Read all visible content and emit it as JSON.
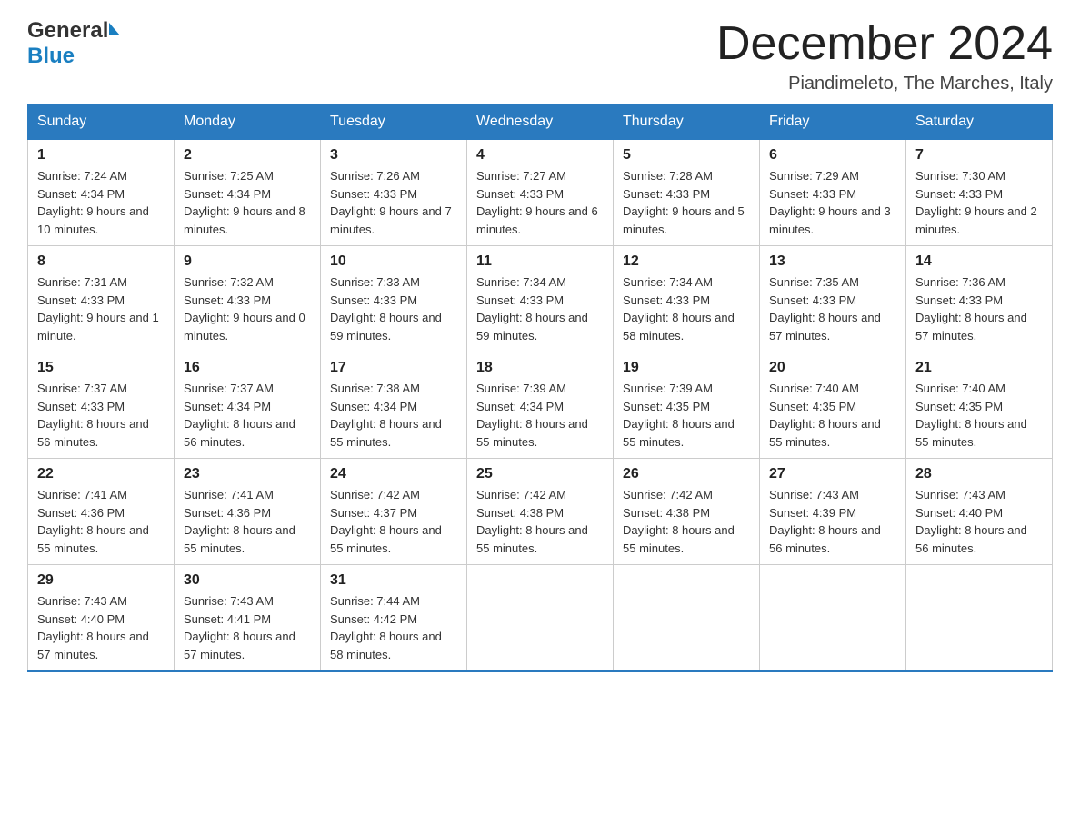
{
  "header": {
    "logo_general": "General",
    "logo_blue": "Blue",
    "month_title": "December 2024",
    "location": "Piandimeleto, The Marches, Italy"
  },
  "days_of_week": [
    "Sunday",
    "Monday",
    "Tuesday",
    "Wednesday",
    "Thursday",
    "Friday",
    "Saturday"
  ],
  "weeks": [
    [
      {
        "day": "1",
        "sunrise": "7:24 AM",
        "sunset": "4:34 PM",
        "daylight": "9 hours and 10 minutes."
      },
      {
        "day": "2",
        "sunrise": "7:25 AM",
        "sunset": "4:34 PM",
        "daylight": "9 hours and 8 minutes."
      },
      {
        "day": "3",
        "sunrise": "7:26 AM",
        "sunset": "4:33 PM",
        "daylight": "9 hours and 7 minutes."
      },
      {
        "day": "4",
        "sunrise": "7:27 AM",
        "sunset": "4:33 PM",
        "daylight": "9 hours and 6 minutes."
      },
      {
        "day": "5",
        "sunrise": "7:28 AM",
        "sunset": "4:33 PM",
        "daylight": "9 hours and 5 minutes."
      },
      {
        "day": "6",
        "sunrise": "7:29 AM",
        "sunset": "4:33 PM",
        "daylight": "9 hours and 3 minutes."
      },
      {
        "day": "7",
        "sunrise": "7:30 AM",
        "sunset": "4:33 PM",
        "daylight": "9 hours and 2 minutes."
      }
    ],
    [
      {
        "day": "8",
        "sunrise": "7:31 AM",
        "sunset": "4:33 PM",
        "daylight": "9 hours and 1 minute."
      },
      {
        "day": "9",
        "sunrise": "7:32 AM",
        "sunset": "4:33 PM",
        "daylight": "9 hours and 0 minutes."
      },
      {
        "day": "10",
        "sunrise": "7:33 AM",
        "sunset": "4:33 PM",
        "daylight": "8 hours and 59 minutes."
      },
      {
        "day": "11",
        "sunrise": "7:34 AM",
        "sunset": "4:33 PM",
        "daylight": "8 hours and 59 minutes."
      },
      {
        "day": "12",
        "sunrise": "7:34 AM",
        "sunset": "4:33 PM",
        "daylight": "8 hours and 58 minutes."
      },
      {
        "day": "13",
        "sunrise": "7:35 AM",
        "sunset": "4:33 PM",
        "daylight": "8 hours and 57 minutes."
      },
      {
        "day": "14",
        "sunrise": "7:36 AM",
        "sunset": "4:33 PM",
        "daylight": "8 hours and 57 minutes."
      }
    ],
    [
      {
        "day": "15",
        "sunrise": "7:37 AM",
        "sunset": "4:33 PM",
        "daylight": "8 hours and 56 minutes."
      },
      {
        "day": "16",
        "sunrise": "7:37 AM",
        "sunset": "4:34 PM",
        "daylight": "8 hours and 56 minutes."
      },
      {
        "day": "17",
        "sunrise": "7:38 AM",
        "sunset": "4:34 PM",
        "daylight": "8 hours and 55 minutes."
      },
      {
        "day": "18",
        "sunrise": "7:39 AM",
        "sunset": "4:34 PM",
        "daylight": "8 hours and 55 minutes."
      },
      {
        "day": "19",
        "sunrise": "7:39 AM",
        "sunset": "4:35 PM",
        "daylight": "8 hours and 55 minutes."
      },
      {
        "day": "20",
        "sunrise": "7:40 AM",
        "sunset": "4:35 PM",
        "daylight": "8 hours and 55 minutes."
      },
      {
        "day": "21",
        "sunrise": "7:40 AM",
        "sunset": "4:35 PM",
        "daylight": "8 hours and 55 minutes."
      }
    ],
    [
      {
        "day": "22",
        "sunrise": "7:41 AM",
        "sunset": "4:36 PM",
        "daylight": "8 hours and 55 minutes."
      },
      {
        "day": "23",
        "sunrise": "7:41 AM",
        "sunset": "4:36 PM",
        "daylight": "8 hours and 55 minutes."
      },
      {
        "day": "24",
        "sunrise": "7:42 AM",
        "sunset": "4:37 PM",
        "daylight": "8 hours and 55 minutes."
      },
      {
        "day": "25",
        "sunrise": "7:42 AM",
        "sunset": "4:38 PM",
        "daylight": "8 hours and 55 minutes."
      },
      {
        "day": "26",
        "sunrise": "7:42 AM",
        "sunset": "4:38 PM",
        "daylight": "8 hours and 55 minutes."
      },
      {
        "day": "27",
        "sunrise": "7:43 AM",
        "sunset": "4:39 PM",
        "daylight": "8 hours and 56 minutes."
      },
      {
        "day": "28",
        "sunrise": "7:43 AM",
        "sunset": "4:40 PM",
        "daylight": "8 hours and 56 minutes."
      }
    ],
    [
      {
        "day": "29",
        "sunrise": "7:43 AM",
        "sunset": "4:40 PM",
        "daylight": "8 hours and 57 minutes."
      },
      {
        "day": "30",
        "sunrise": "7:43 AM",
        "sunset": "4:41 PM",
        "daylight": "8 hours and 57 minutes."
      },
      {
        "day": "31",
        "sunrise": "7:44 AM",
        "sunset": "4:42 PM",
        "daylight": "8 hours and 58 minutes."
      },
      null,
      null,
      null,
      null
    ]
  ],
  "labels": {
    "sunrise": "Sunrise:",
    "sunset": "Sunset:",
    "daylight": "Daylight:"
  }
}
